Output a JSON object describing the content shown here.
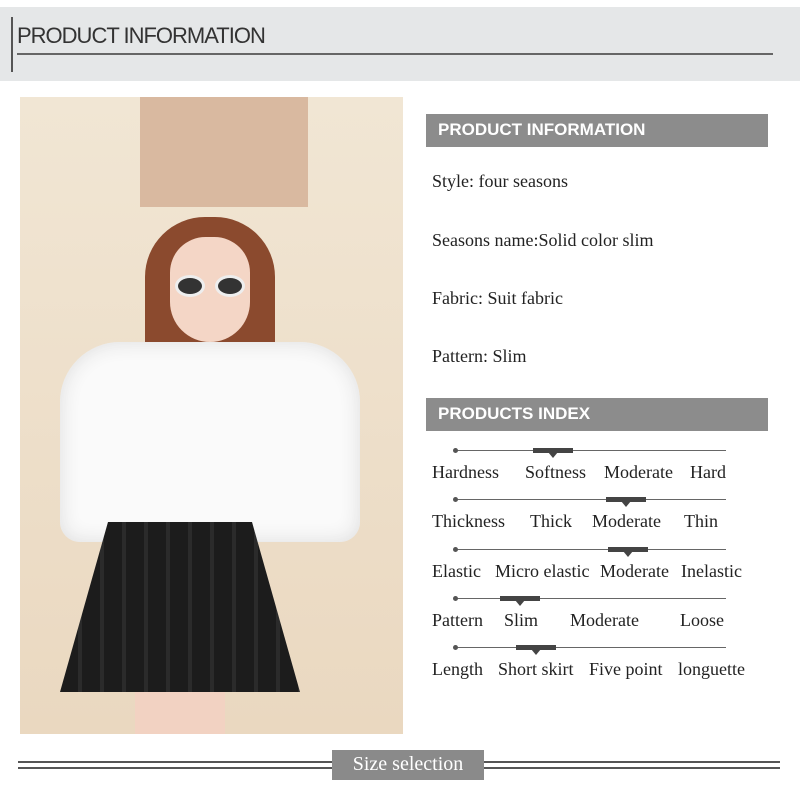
{
  "header": {
    "title": "PRODUCT INFORMATION"
  },
  "info_section": {
    "title": "PRODUCT INFORMATION",
    "items": [
      "Style: four seasons",
      "Seasons name:Solid color slim",
      "Fabric: Suit fabric",
      "Pattern: Slim"
    ]
  },
  "index_section": {
    "title": "PRODUCTS INDEX",
    "rows": [
      {
        "label": "Hardness",
        "options": [
          "Softness",
          "Moderate",
          "Hard"
        ],
        "level": 0.36
      },
      {
        "label": "Thickness",
        "options": [
          "Thick",
          "Moderate",
          "Thin"
        ],
        "level": 0.63
      },
      {
        "label": "Elastic",
        "options": [
          "Micro elastic",
          "Moderate",
          "Inelastic"
        ],
        "level": 0.64
      },
      {
        "label": "Pattern",
        "options": [
          "Slim",
          "Moderate",
          "Loose"
        ],
        "level": 0.24
      },
      {
        "label": "Length",
        "options": [
          "Short skirt",
          "Five point",
          "longuette"
        ],
        "level": 0.3
      }
    ]
  },
  "footer": {
    "label": "Size selection"
  },
  "colors": {
    "section_bg": "#8c8c8c",
    "header_bg": "#e5e7e8"
  }
}
